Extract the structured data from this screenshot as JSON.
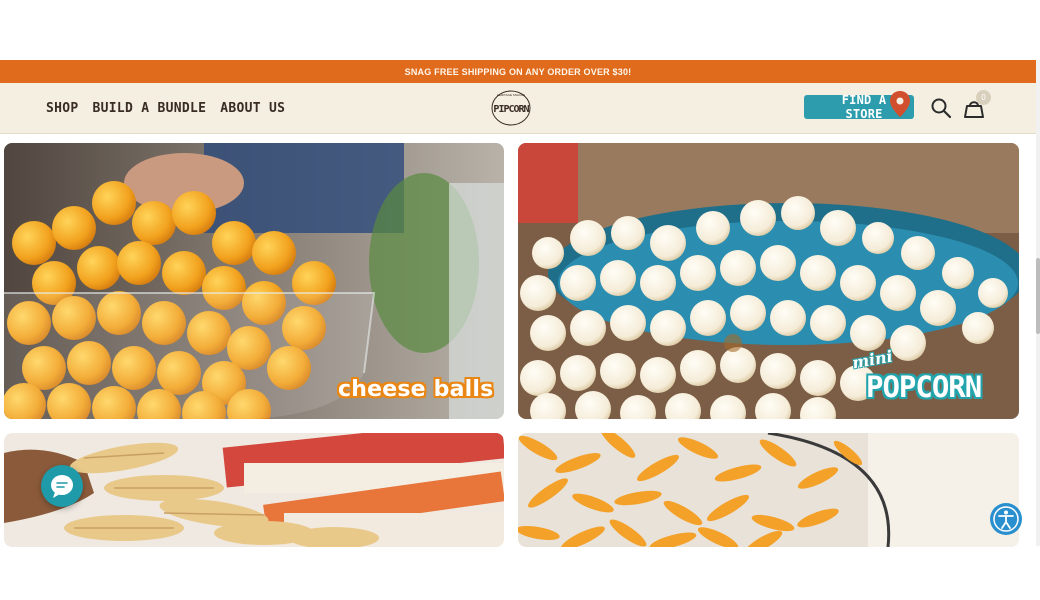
{
  "promo": {
    "text": "SNAG FREE SHIPPING ON ANY ORDER OVER $30!"
  },
  "nav": {
    "items": [
      "SHOP",
      "BUILD A BUNDLE",
      "ABOUT US"
    ]
  },
  "logo": {
    "text": "PIPCORN",
    "ring_text": "HERITAGE SNACKS",
    "icon": "pipcorn-logo"
  },
  "header": {
    "find_store_label": "FIND A STORE",
    "cart_count": "0",
    "icons": [
      "map-pin-icon",
      "search-icon",
      "cart-icon"
    ]
  },
  "products": [
    {
      "label": "cheese balls"
    },
    {
      "label_small": "mini",
      "label_big": "POPCORN"
    },
    {
      "label": ""
    },
    {
      "label": ""
    }
  ],
  "widgets": {
    "chat_icon": "chat-bubble-icon",
    "accessibility_icon": "accessibility-icon"
  },
  "colors": {
    "promo": "#e06b1c",
    "header_bg": "#f4efe1",
    "accent_teal": "#2d9dae",
    "text_dark": "#3a2c22"
  }
}
